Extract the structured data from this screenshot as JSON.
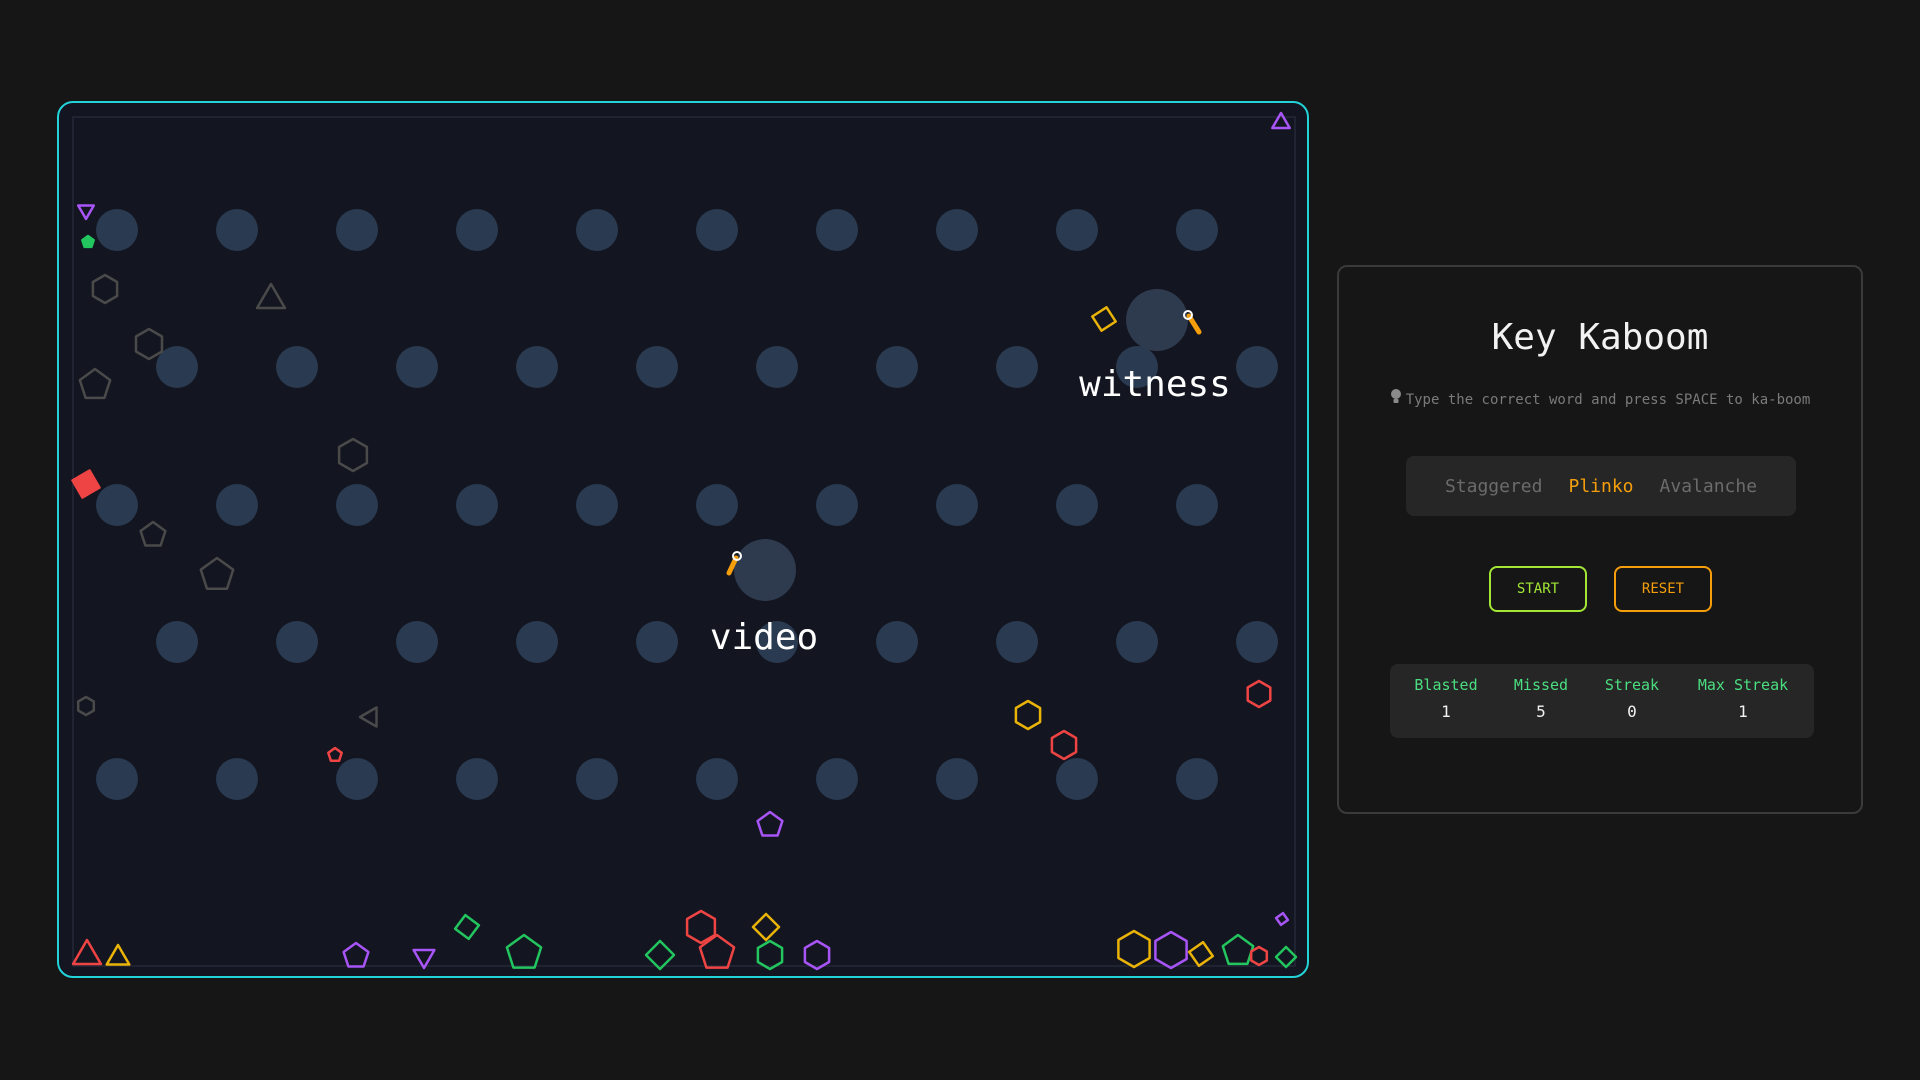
{
  "game": {
    "falling_words": [
      {
        "text": "witness"
      },
      {
        "text": "video"
      }
    ],
    "peg_color": "#2a3a50",
    "arena_border_color": "#22d3d8",
    "piece_colors": {
      "red": "#ef4444",
      "yellow": "#eab308",
      "green": "#22c55e",
      "purple": "#a855f7",
      "gray": "#4a4a4a",
      "fuse": "#f59e0b"
    }
  },
  "panel": {
    "title": "Key Kaboom",
    "hint_icon": "lightbulb-icon",
    "hint": "Type the correct word and press SPACE to ka-boom",
    "modes": [
      {
        "label": "Staggered",
        "active": false
      },
      {
        "label": "Plinko",
        "active": true
      },
      {
        "label": "Avalanche",
        "active": false
      }
    ],
    "start_label": "START",
    "reset_label": "RESET",
    "stats": [
      {
        "label": "Blasted",
        "value": "1"
      },
      {
        "label": "Missed",
        "value": "5"
      },
      {
        "label": "Streak",
        "value": "0"
      },
      {
        "label": "Max Streak",
        "value": "1"
      }
    ]
  }
}
